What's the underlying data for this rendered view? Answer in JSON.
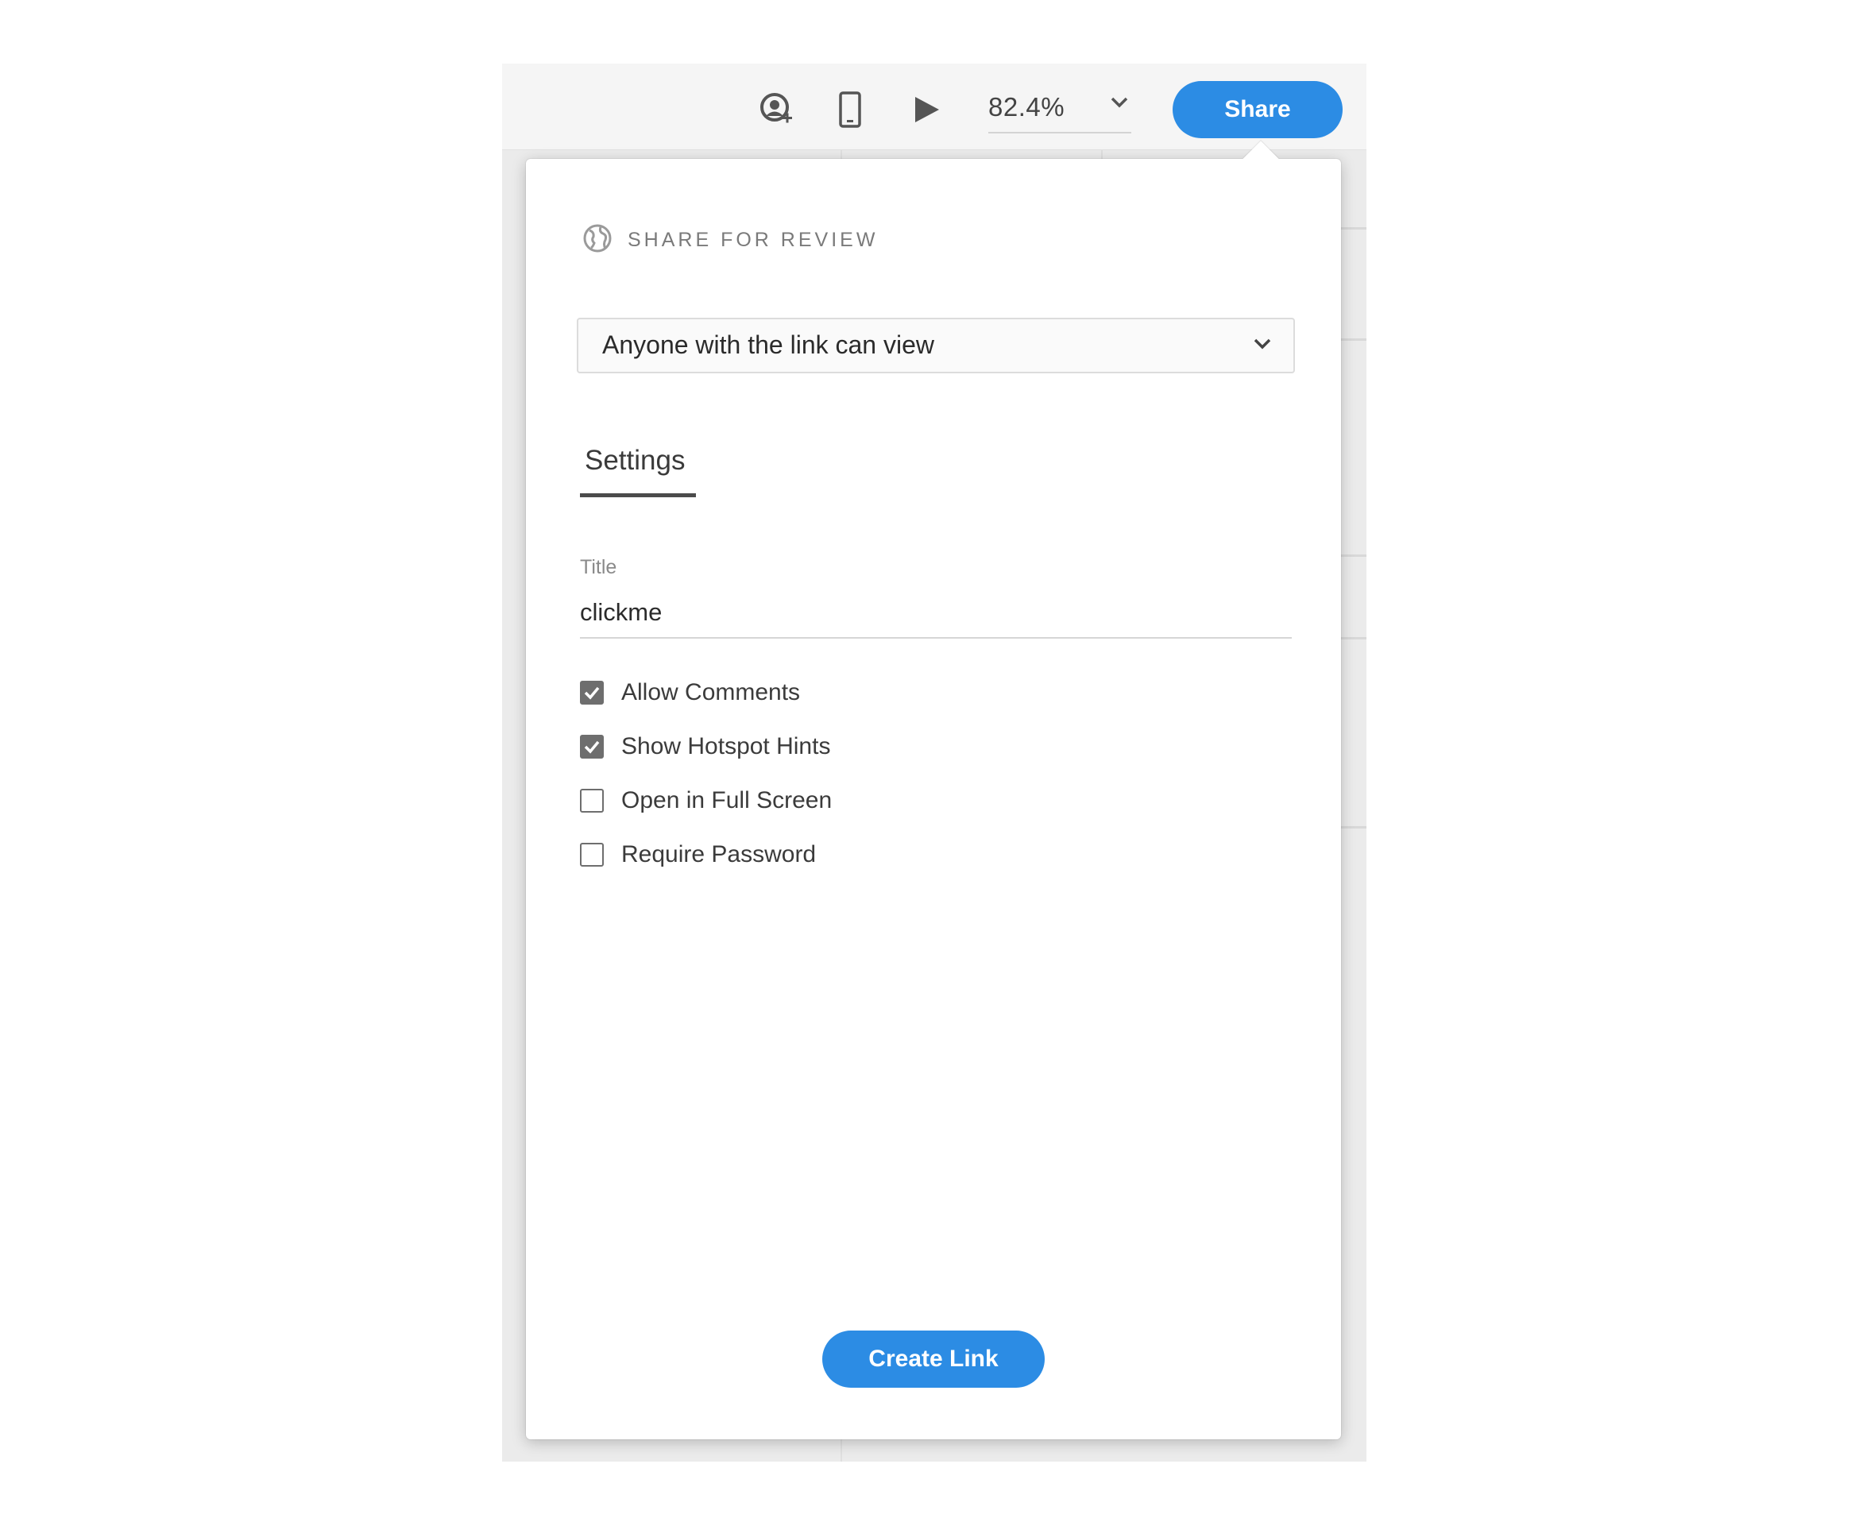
{
  "toolbar": {
    "zoom_value": "82.4%",
    "share_label": "Share",
    "icons": [
      "invite-user-icon",
      "device-preview-icon",
      "play-icon",
      "chevron-down-icon"
    ]
  },
  "popover": {
    "header_title": "SHARE FOR REVIEW",
    "header_icon": "globe-icon",
    "access_select": {
      "selected": "Anyone with the link can view"
    },
    "tabs": [
      {
        "label": "Settings",
        "active": true
      }
    ],
    "title_field": {
      "label": "Title",
      "value": "clickme"
    },
    "options": [
      {
        "label": "Allow Comments",
        "checked": true
      },
      {
        "label": "Show Hotspot Hints",
        "checked": true
      },
      {
        "label": "Open in Full Screen",
        "checked": false
      },
      {
        "label": "Require Password",
        "checked": false
      }
    ],
    "create_link_label": "Create Link"
  },
  "colors": {
    "accent": "#2c8ce4",
    "toolbar_bg": "#f5f5f5",
    "canvas_bg": "#ebebeb",
    "checkbox": "#6e6e6e"
  }
}
